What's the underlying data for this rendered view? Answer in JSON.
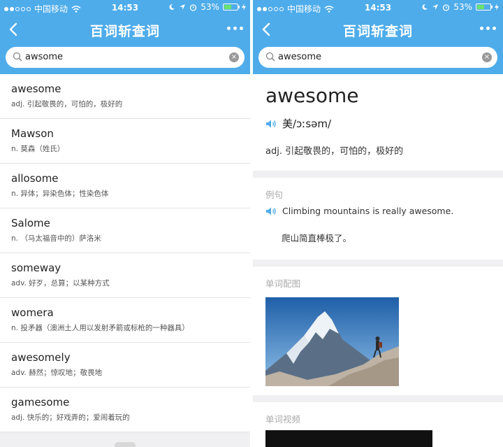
{
  "status": {
    "carrier": "中国移动",
    "time": "14:53",
    "battery": "53%",
    "battery_level": 0.53
  },
  "nav": {
    "title": "百词斩查词"
  },
  "search": {
    "left_value": "awsome",
    "right_value": "awesome"
  },
  "results": [
    {
      "word": "awesome",
      "def": "adj. 引起敬畏的，可怕的，极好的"
    },
    {
      "word": "Mawson",
      "def": "n. 莫森（姓氏）"
    },
    {
      "word": "allosome",
      "def": "n. 异体；异染色体；性染色体"
    },
    {
      "word": "Salome",
      "def": "n. （马太福音中的）萨洛米"
    },
    {
      "word": "someway",
      "def": "adv. 好歹，总算；以某种方式"
    },
    {
      "word": "womera",
      "def": "n. 投矛器（澳洲土人用以发射矛箭或标枪的一种器具）"
    },
    {
      "word": "awesomely",
      "def": "adv. 赫然；惊叹地；敬畏地"
    },
    {
      "word": "gamesome",
      "def": "adj. 快乐的；好戏弄的；爱闹着玩的"
    }
  ],
  "detail": {
    "headword": "awesome",
    "pronunciation": "美/ɔːsəm/",
    "meaning": "adj. 引起敬畏的，可怕的，极好的",
    "example_label": "例句",
    "example_sentence": "Climbing mountains is really awesome.",
    "example_translation": "爬山简直棒极了。",
    "image_label": "单词配图",
    "video_label": "单词视频"
  },
  "colors": {
    "header": "#4eacea",
    "speaker": "#4eacea"
  }
}
